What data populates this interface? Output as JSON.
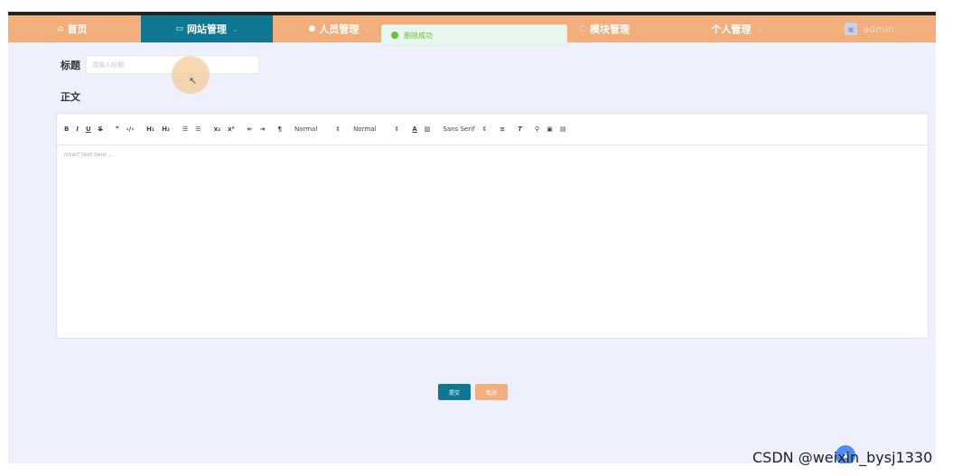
{
  "nav": {
    "items": [
      {
        "icon": "home-icon",
        "label": "首页"
      },
      {
        "icon": "monitor-icon",
        "label": "网站管理"
      },
      {
        "icon": "user-icon",
        "label": "人员管理"
      },
      {
        "icon": "chat-icon",
        "label": "模块管理"
      },
      {
        "icon": "none",
        "label": "个人管理"
      }
    ],
    "user": {
      "name": "admin"
    }
  },
  "toast": {
    "message": "删除成功"
  },
  "form": {
    "title_label": "标题",
    "title_placeholder": "请输入标题",
    "body_label": "正文"
  },
  "editor": {
    "size_value": "Normal",
    "header_value": "Normal",
    "font_value": "Sans Serif",
    "placeholder": "Insert text here ..."
  },
  "buttons": {
    "submit": "提交",
    "cancel": "取消"
  },
  "watermark": "CSDN @weixin_bysj1330",
  "colors": {
    "nav_bg": "#f2ae7b",
    "nav_active": "#0e7791",
    "page_bg": "#eff0fd",
    "success": "#67c23a"
  }
}
